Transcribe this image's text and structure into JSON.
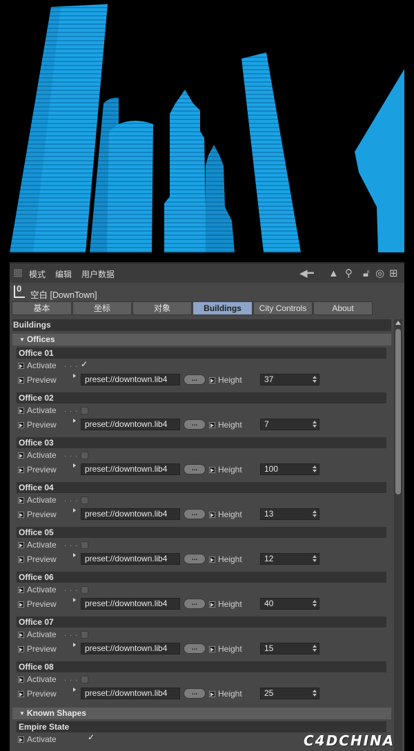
{
  "colors": {
    "building": "#1aa0e0",
    "panel_bg": "#474747",
    "active_tab": "#8ea5c9",
    "field_bg": "#2e2e2e"
  },
  "menubar": {
    "items": [
      "模式",
      "编辑",
      "用户数据"
    ],
    "icons": [
      "arrow-left-icon",
      "arrow-up-icon",
      "search-icon",
      "lock-icon",
      "target-icon",
      "plus-icon"
    ]
  },
  "object": {
    "icon": "null-object-icon",
    "icon_glyph": "0",
    "title": "空白 [DownTown]"
  },
  "tabs": [
    {
      "label": "基本",
      "active": false
    },
    {
      "label": "坐标",
      "active": false
    },
    {
      "label": "对象",
      "active": false
    },
    {
      "label": "Buildings",
      "active": true
    },
    {
      "label": "City Controls",
      "active": false
    },
    {
      "label": "About",
      "active": false
    }
  ],
  "section_title": "Buildings",
  "offices_group": "Offices",
  "labels": {
    "activate": "Activate",
    "preview": "Preview",
    "height": "Height",
    "browse": "..."
  },
  "offices": [
    {
      "name": "Office 01",
      "activated": true,
      "preset": "preset://downtown.lib4",
      "height": "37"
    },
    {
      "name": "Office 02",
      "activated": false,
      "preset": "preset://downtown.lib4",
      "height": "7"
    },
    {
      "name": "Office 03",
      "activated": false,
      "preset": "preset://downtown.lib4",
      "height": "100"
    },
    {
      "name": "Office 04",
      "activated": false,
      "preset": "preset://downtown.lib4",
      "height": "13"
    },
    {
      "name": "Office 05",
      "activated": false,
      "preset": "preset://downtown.lib4",
      "height": "12"
    },
    {
      "name": "Office 06",
      "activated": false,
      "preset": "preset://downtown.lib4",
      "height": "40"
    },
    {
      "name": "Office 07",
      "activated": false,
      "preset": "preset://downtown.lib4",
      "height": "15"
    },
    {
      "name": "Office 08",
      "activated": false,
      "preset": "preset://downtown.lib4",
      "height": "25"
    }
  ],
  "known_group": "Known Shapes",
  "known_first": {
    "name": "Empire State",
    "activated": true
  },
  "watermark": "C4DCHINA"
}
